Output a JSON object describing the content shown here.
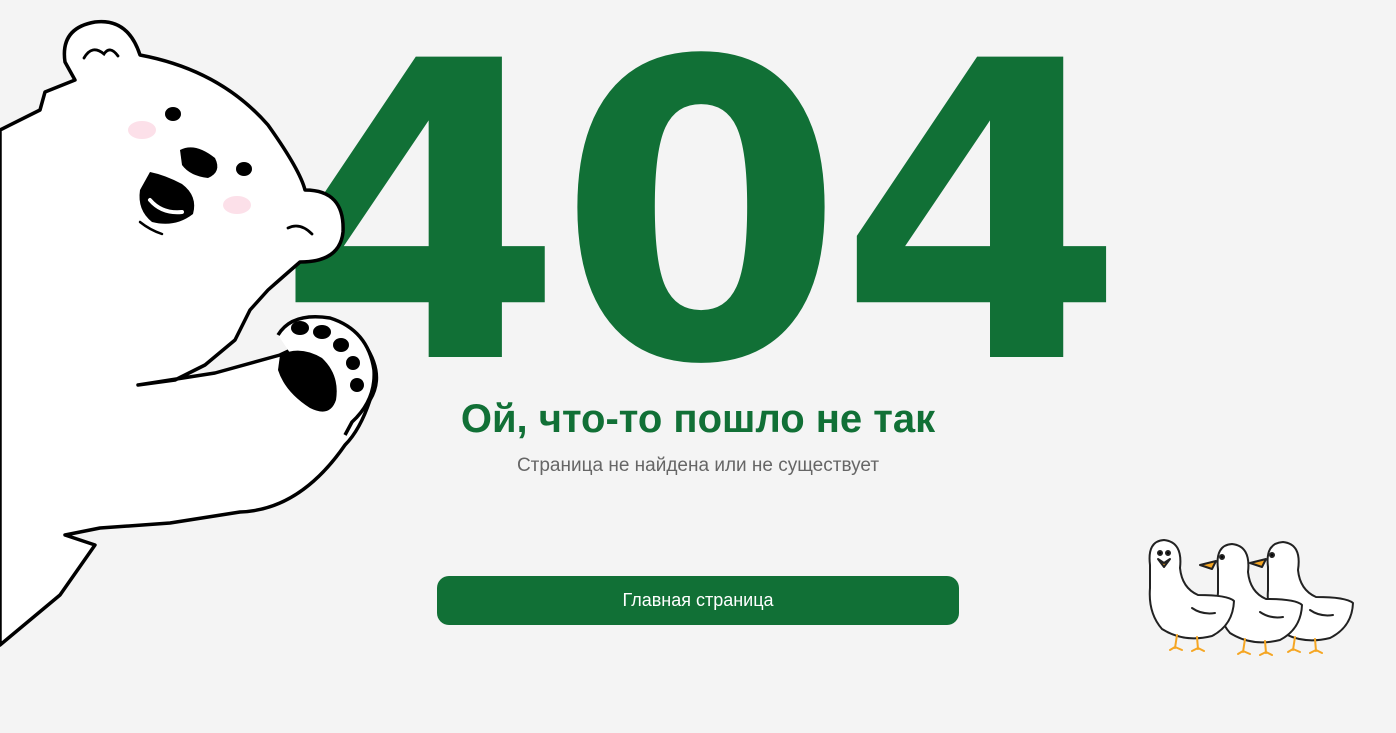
{
  "error": {
    "code": "404",
    "headline": "Ой, что-то пошло не так",
    "message": "Страница не найдена или не существует"
  },
  "actions": {
    "home_label": "Главная страница"
  },
  "theme": {
    "accent": "#117036",
    "background": "#f4f4f4",
    "muted_text": "#666666"
  },
  "illustrations": {
    "left": "polar-bear-illustration",
    "right": "geese-illustration"
  }
}
